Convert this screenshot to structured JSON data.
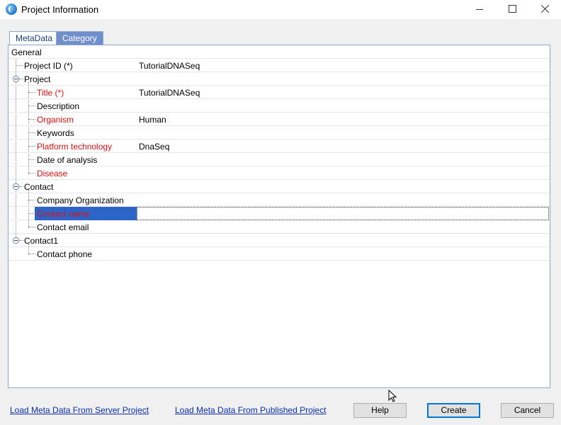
{
  "window": {
    "title": "Project Information",
    "icon": "app-icon"
  },
  "tabs": [
    {
      "label": "MetaData",
      "active": true
    },
    {
      "label": "Category",
      "active": false
    }
  ],
  "tree": {
    "general": {
      "label": "General"
    },
    "project_id": {
      "label": "Project ID (*)",
      "value": "TutorialDNASeq"
    },
    "project": {
      "label": "Project",
      "fields": {
        "title": {
          "label": "Title (*)",
          "value": "TutorialDNASeq",
          "required": true
        },
        "description": {
          "label": "Description",
          "value": ""
        },
        "organism": {
          "label": "Organism",
          "value": "Human",
          "required": true
        },
        "keywords": {
          "label": "Keywords",
          "value": ""
        },
        "platform": {
          "label": "Platform technology",
          "value": "DnaSeq",
          "required": true
        },
        "date": {
          "label": "Date of analysis",
          "value": ""
        },
        "disease": {
          "label": "Disease",
          "value": "",
          "required": true
        }
      }
    },
    "contact": {
      "label": "Contact",
      "fields": {
        "company": {
          "label": "Company Organization",
          "value": ""
        },
        "name": {
          "label": "Contact name",
          "value": "",
          "required": true,
          "selected": true
        },
        "email": {
          "label": "Contact email",
          "value": ""
        }
      }
    },
    "contact1": {
      "label": "Contact1",
      "fields": {
        "phone": {
          "label": "Contact phone",
          "value": ""
        }
      }
    }
  },
  "footer": {
    "link_server": "Load Meta Data From Server Project",
    "link_published": "Load Meta Data From Published Project",
    "help": "Help",
    "create": "Create",
    "cancel": "Cancel"
  },
  "colors": {
    "required": "#e01010",
    "selection": "#2c64c8",
    "link": "#0a2eb0",
    "tab_inactive": "#6f8fcc"
  }
}
